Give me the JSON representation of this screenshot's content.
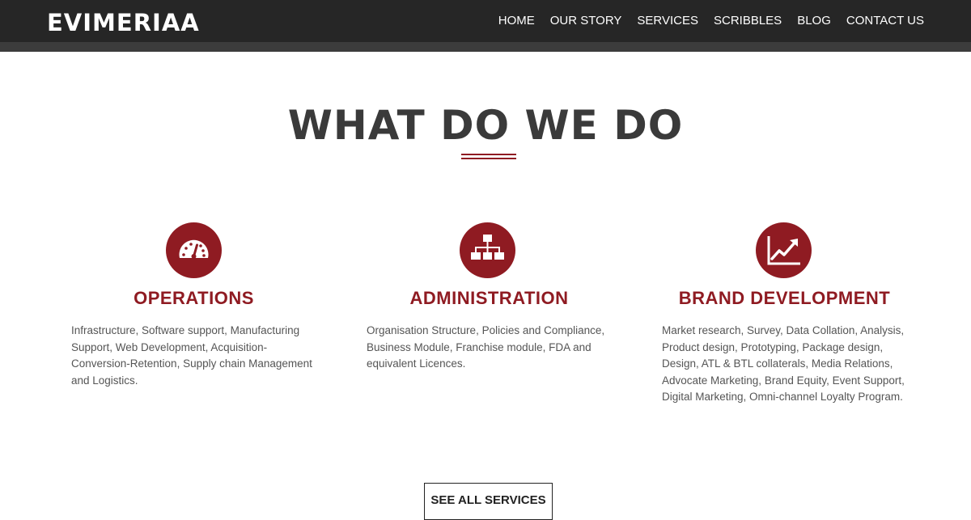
{
  "header": {
    "brand": "EVIMERIAA",
    "nav": [
      "HOME",
      "OUR STORY",
      "SERVICES",
      "SCRIBBLES",
      "BLOG",
      "CONTACT US"
    ]
  },
  "section": {
    "title": "WHAT DO WE DO"
  },
  "services": [
    {
      "icon": "speedometer-icon",
      "title": "OPERATIONS",
      "text": "Infrastructure, Software support, Manufacturing Support, Web Development, Acquisition-Conversion-Retention, Supply chain Management and Logistics."
    },
    {
      "icon": "org-chart-icon",
      "title": "ADMINISTRATION",
      "text": "Organisation Structure, Policies and Compliance, Business Module, Franchise module, FDA and equivalent Licences."
    },
    {
      "icon": "growth-chart-icon",
      "title": "BRAND DEVELOPMENT",
      "text": "Market research, Survey, Data Collation, Analysis, Product design, Prototyping, Package design, Design, ATL & BTL collaterals, Media Relations, Advocate Marketing, Brand Equity, Event Support, Digital Marketing, Omni-channel Loyalty Program."
    }
  ],
  "cta": {
    "label": "SEE ALL SERVICES"
  },
  "colors": {
    "accent": "#8f1b22",
    "navbar": "#262626",
    "navbar_border": "#3c3c3c",
    "heading": "#3a3a3a",
    "body_text": "#555555"
  }
}
